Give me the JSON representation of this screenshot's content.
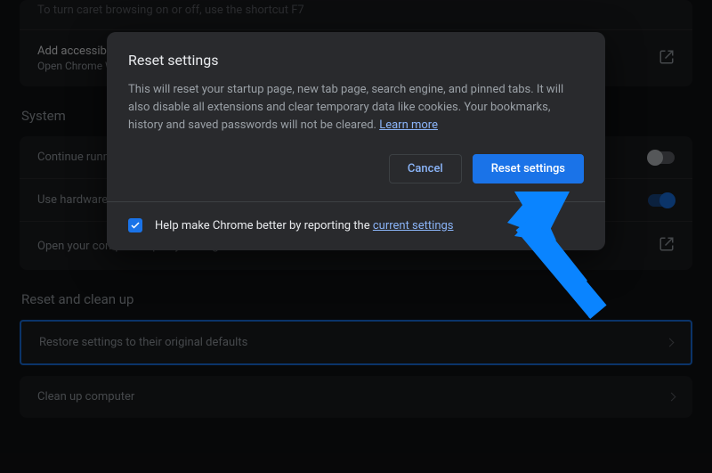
{
  "top_card": {
    "caret_text": "To turn caret browsing on or off, use the shortcut F7",
    "accessibility_title": "Add accessibility features",
    "accessibility_sub": "Open Chrome Web Store"
  },
  "system": {
    "heading": "System",
    "continue_row": "Continue running background apps when Google Chrome is closed",
    "hardware_row": "Use hardware acceleration when available",
    "proxy_row": "Open your computer's proxy settings"
  },
  "reset": {
    "heading": "Reset and clean up",
    "restore_row": "Restore settings to their original defaults",
    "cleanup_row": "Clean up computer"
  },
  "modal": {
    "title": "Reset settings",
    "body_text": "This will reset your startup page, new tab page, search engine, and pinned tabs. It will also disable all extensions and clear temporary data like cookies. Your bookmarks, history and saved passwords will not be cleared. ",
    "learn_more": "Learn more",
    "cancel": "Cancel",
    "confirm": "Reset settings",
    "footer_prefix": "Help make Chrome better by reporting the ",
    "footer_link": "current settings"
  }
}
